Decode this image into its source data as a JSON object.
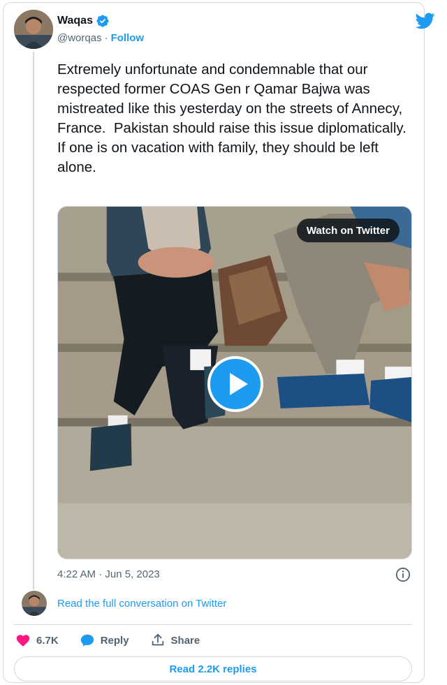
{
  "author": {
    "name": "Waqas",
    "handle": "@worqas",
    "separator": "·",
    "follow_label": "Follow"
  },
  "tweet": {
    "text": "Extremely unfortunate and condemnable that our respected former COAS Gen r Qamar Bajwa was mistreated like this yesterday on the streets of Annecy, France.  Pakistan should raise this issue diplomatically.\nIf one is on vacation with family, they should be left alone.",
    "timestamp": "4:22 AM · Jun 5, 2023"
  },
  "media": {
    "watch_label": "Watch on Twitter",
    "type": "video"
  },
  "conversation": {
    "read_full_label": "Read the full conversation on Twitter"
  },
  "actions": {
    "like_count": "6.7K",
    "reply_label": "Reply",
    "share_label": "Share"
  },
  "footer": {
    "read_replies_label": "Read 2.2K replies"
  },
  "icons": {
    "verified": "verified-badge-icon",
    "brand": "twitter-bird-icon",
    "info": "info-icon",
    "like": "heart-icon",
    "reply": "speech-bubble-icon",
    "share": "share-arrow-icon",
    "play": "play-icon"
  },
  "colors": {
    "accent": "#1d9bf0",
    "like": "#f91880",
    "text": "#0f1419",
    "muted": "#536471",
    "border": "#cfd9de"
  }
}
